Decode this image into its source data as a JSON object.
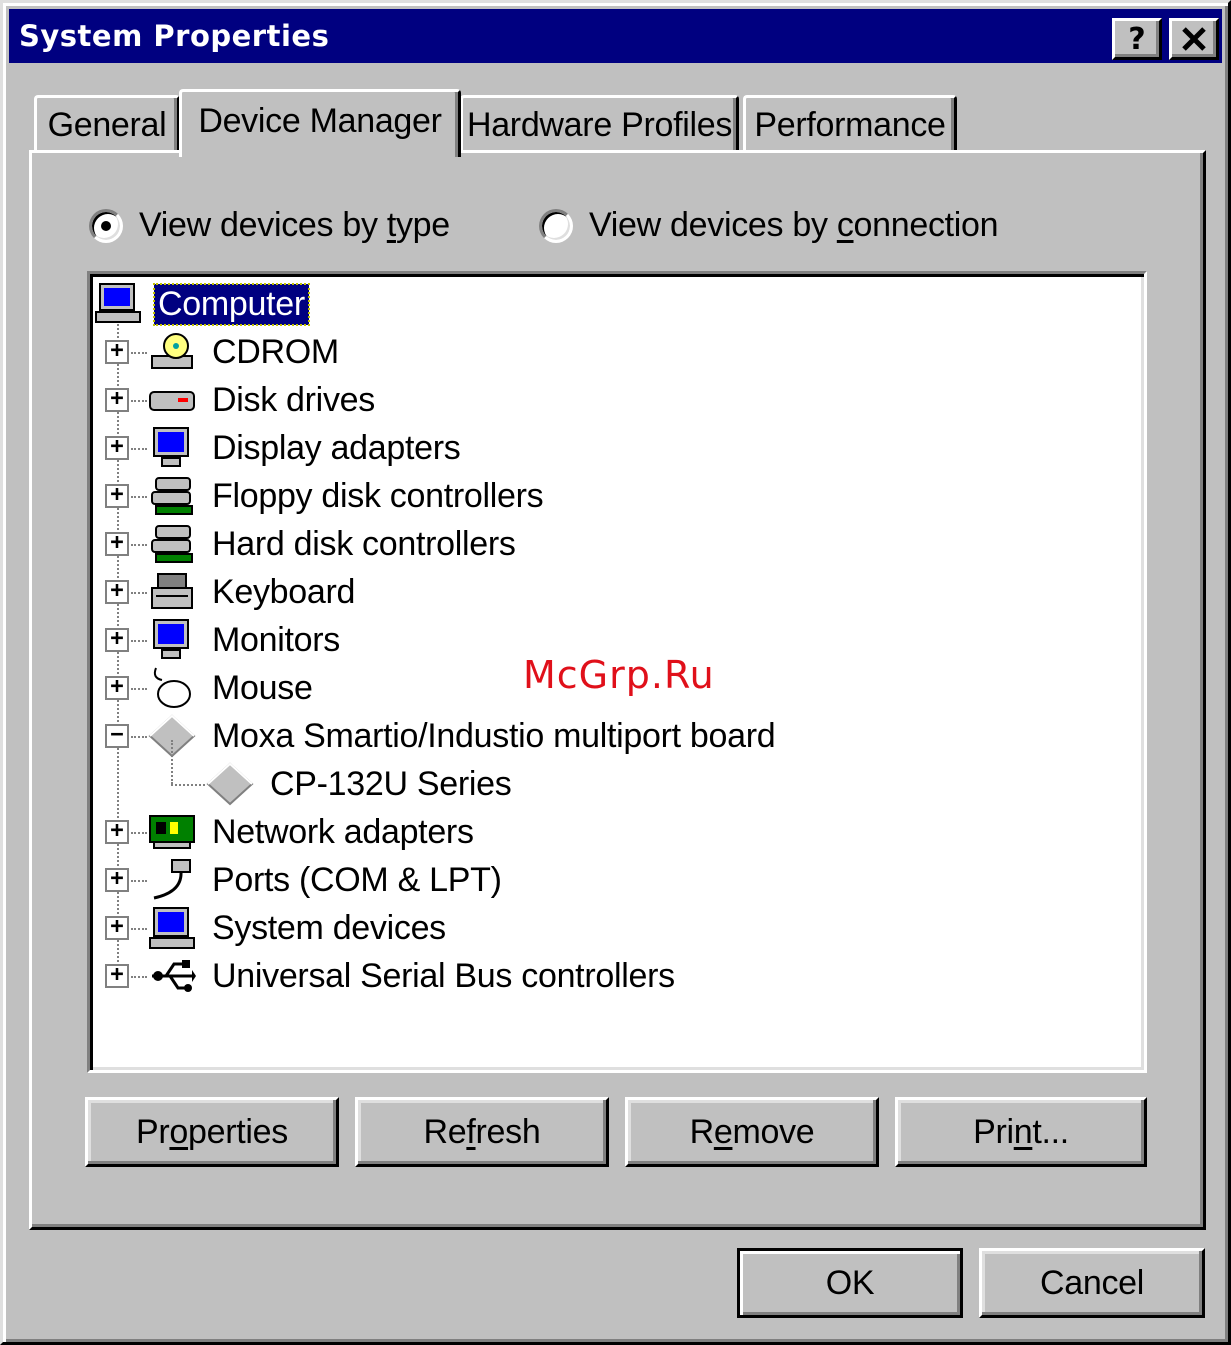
{
  "window": {
    "title": "System Properties",
    "help_label": "?",
    "close_label": "✕"
  },
  "tabs": [
    {
      "label": "General",
      "active": false
    },
    {
      "label": "Device Manager",
      "active": true
    },
    {
      "label": "Hardware Profiles",
      "active": false
    },
    {
      "label": "Performance",
      "active": false
    }
  ],
  "view_options": {
    "by_type": {
      "pre": "View devices by ",
      "ul": "t",
      "post": "ype",
      "checked": true
    },
    "by_connection": {
      "pre": "View devices by ",
      "ul": "c",
      "post": "onnection",
      "checked": false
    }
  },
  "tree": {
    "root": {
      "label": "Computer",
      "icon": "computer-icon",
      "selected": true
    },
    "items": [
      {
        "label": "CDROM",
        "icon": "cdrom-icon",
        "expander": "+"
      },
      {
        "label": "Disk drives",
        "icon": "disk-drive-icon",
        "expander": "+"
      },
      {
        "label": "Display adapters",
        "icon": "display-adapter-icon",
        "expander": "+"
      },
      {
        "label": "Floppy disk controllers",
        "icon": "disk-controller-icon",
        "expander": "+"
      },
      {
        "label": "Hard disk controllers",
        "icon": "disk-controller-icon",
        "expander": "+"
      },
      {
        "label": "Keyboard",
        "icon": "keyboard-icon",
        "expander": "+"
      },
      {
        "label": "Monitors",
        "icon": "monitor-icon",
        "expander": "+"
      },
      {
        "label": "Mouse",
        "icon": "mouse-icon",
        "expander": "+"
      },
      {
        "label": "Moxa Smartio/Industio multiport board",
        "icon": "diamond-icon",
        "expander": "−"
      },
      {
        "label": "CP-132U Series",
        "icon": "diamond-icon",
        "child": true
      },
      {
        "label": "Network adapters",
        "icon": "network-adapter-icon",
        "expander": "+"
      },
      {
        "label": "Ports (COM & LPT)",
        "icon": "port-icon",
        "expander": "+"
      },
      {
        "label": "System devices",
        "icon": "system-device-icon",
        "expander": "+"
      },
      {
        "label": "Universal Serial Bus controllers",
        "icon": "usb-icon",
        "expander": "+"
      }
    ]
  },
  "buttons": {
    "properties": {
      "pre": "Pr",
      "ul": "o",
      "post": "perties"
    },
    "refresh": {
      "pre": "Re",
      "ul": "f",
      "post": "resh"
    },
    "remove": {
      "pre": "R",
      "ul": "e",
      "post": "move"
    },
    "print": {
      "pre": "Pri",
      "ul": "n",
      "post": "t..."
    },
    "ok": "OK",
    "cancel": "Cancel"
  },
  "watermark": "McGrp.Ru",
  "colors": {
    "face": "#c0c0c0",
    "titlebar": "#000080",
    "selection": "#000080",
    "watermark": "#e0101a"
  }
}
